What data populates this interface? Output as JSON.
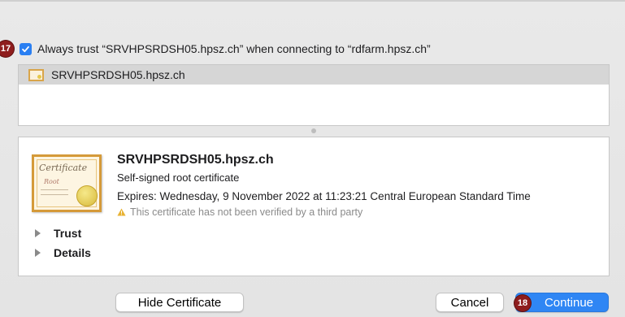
{
  "badges": {
    "trust_step": "17",
    "continue_step": "18"
  },
  "trust_option": {
    "checked": true,
    "label": "Always trust “SRVHPSRDSH05.hpsz.ch” when connecting to “rdfarm.hpsz.ch”"
  },
  "certificate_list": {
    "items": [
      {
        "label": "SRVHPSRDSH05.hpsz.ch",
        "icon": "certificate-icon"
      }
    ]
  },
  "certificate_details": {
    "image_text": {
      "title": "Certificate",
      "subtitle": "Root"
    },
    "name": "SRVHPSRDSH05.hpsz.ch",
    "type": "Self-signed root certificate",
    "expires": "Expires: Wednesday, 9 November 2022 at 11:23:21 Central European Standard Time",
    "warning": "This certificate has not been verified by a third party",
    "sections": {
      "trust": "Trust",
      "details": "Details"
    }
  },
  "buttons": {
    "hide_certificate": "Hide Certificate",
    "cancel": "Cancel",
    "continue": "Continue"
  },
  "colors": {
    "accent": "#2f86f4",
    "badge": "#8e1d1d",
    "warning": "#e8b232"
  }
}
